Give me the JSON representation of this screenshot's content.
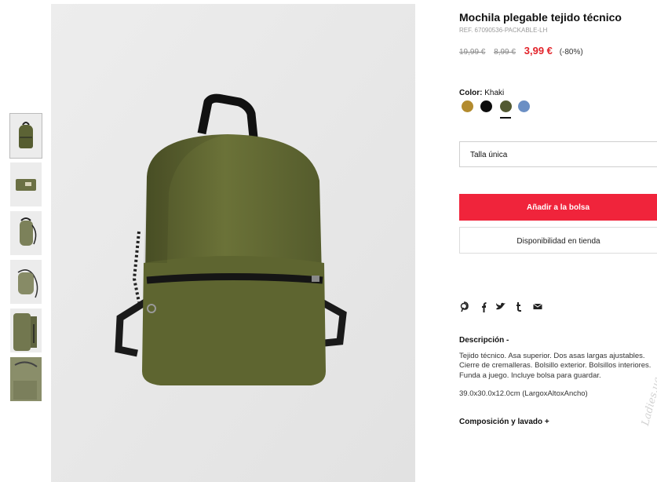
{
  "product": {
    "title": "Mochila plegable tejido técnico",
    "ref": "REF. 67090536-PACKABLE-LH",
    "price_old_1": "19,99 €",
    "price_old_2": "8,99 €",
    "price_current": "3,99 €",
    "discount": "(-80%)"
  },
  "color": {
    "label": "Color:",
    "value": "Khaki",
    "swatches": [
      {
        "name": "mustard",
        "hex": "#b38b2e"
      },
      {
        "name": "black",
        "hex": "#0c0c0c"
      },
      {
        "name": "khaki",
        "hex": "#535a32"
      },
      {
        "name": "blue",
        "hex": "#6b8fc4"
      }
    ],
    "selected_index": 2
  },
  "size": {
    "value": "Talla única"
  },
  "actions": {
    "add_to_bag": "Añadir a la bolsa",
    "store_availability": "Disponibilidad en tienda"
  },
  "share_icons": [
    "pinterest-icon",
    "facebook-icon",
    "twitter-icon",
    "tumblr-icon",
    "email-icon"
  ],
  "description": {
    "title": "Descripción -",
    "line1": "Tejido técnico. Asa superior. Dos asas largas ajustables.",
    "line2": "Cierre de cremalleras. Bolsillo exterior. Bolsillos interiores.",
    "line3": "Funda a juego. Incluye bolsa para guardar.",
    "dimensions": "39.0x30.0x12.0cm (LargoxAltoxAncho)"
  },
  "composition": {
    "title": "Composición y lavado +"
  },
  "watermark": "Ladies.ua"
}
